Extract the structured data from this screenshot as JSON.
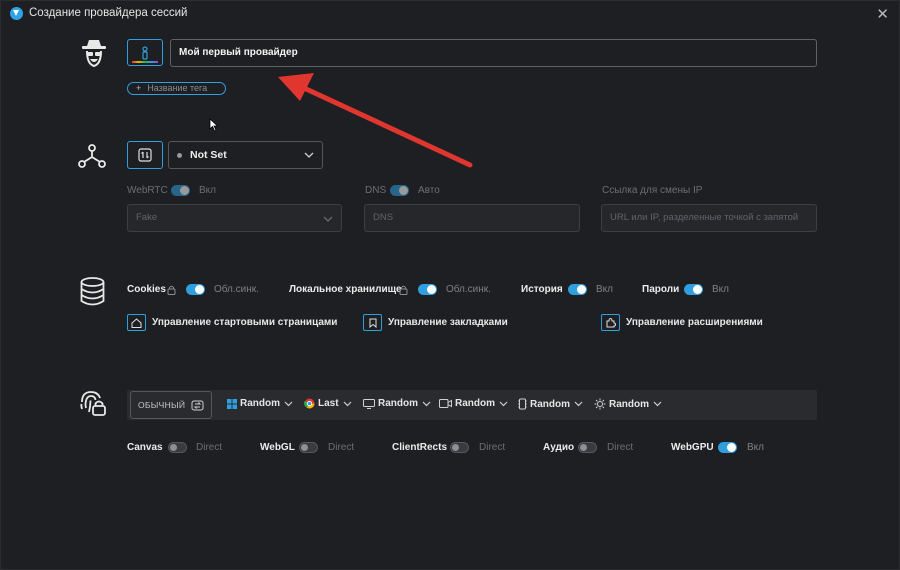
{
  "window": {
    "title": "Создание провайдера сессий"
  },
  "profile": {
    "name_value": "Мой первый провайдер",
    "tag_label": "Название тега"
  },
  "network": {
    "proxy_value": "Not Set",
    "webrtc": {
      "label": "WebRTC",
      "state": "Вкл",
      "value": "Fake"
    },
    "dns": {
      "label": "DNS",
      "state": "Авто",
      "placeholder": "DNS"
    },
    "ip_change": {
      "label": "Ссылка для смены IP",
      "placeholder": "URL или IP, разделенные точкой с запятой"
    }
  },
  "storage": {
    "toggles": [
      {
        "label": "Cookies",
        "state": "Обл.синк."
      },
      {
        "label": "Локальное хранилище",
        "state": "Обл.синк."
      },
      {
        "label": "История",
        "state": "Вкл"
      },
      {
        "label": "Пароли",
        "state": "Вкл"
      }
    ],
    "links": [
      {
        "label": "Управление стартовыми страницами"
      },
      {
        "label": "Управление закладками"
      },
      {
        "label": "Управление расширениями"
      }
    ]
  },
  "fingerprint": {
    "mode_label": "ОБЫЧНЫЙ",
    "dropdowns": [
      {
        "icon": "windows-icon",
        "value": "Random"
      },
      {
        "icon": "chrome-icon",
        "value": "Last"
      },
      {
        "icon": "monitor-icon",
        "value": "Random"
      },
      {
        "icon": "camera-icon",
        "value": "Random"
      },
      {
        "icon": "cpu-icon",
        "value": "Random"
      },
      {
        "icon": "settings-icon",
        "value": "Random"
      }
    ],
    "toggles": [
      {
        "label": "Canvas",
        "state": "Direct",
        "on": false
      },
      {
        "label": "WebGL",
        "state": "Direct",
        "on": false
      },
      {
        "label": "ClientRects",
        "state": "Direct",
        "on": false
      },
      {
        "label": "Аудио",
        "state": "Direct",
        "on": false
      },
      {
        "label": "WebGPU",
        "state": "Вкл",
        "on": true
      }
    ]
  },
  "colors": {
    "accent": "#2f9fe0",
    "arrow": "#e0362f",
    "background": "#1e1f22"
  }
}
